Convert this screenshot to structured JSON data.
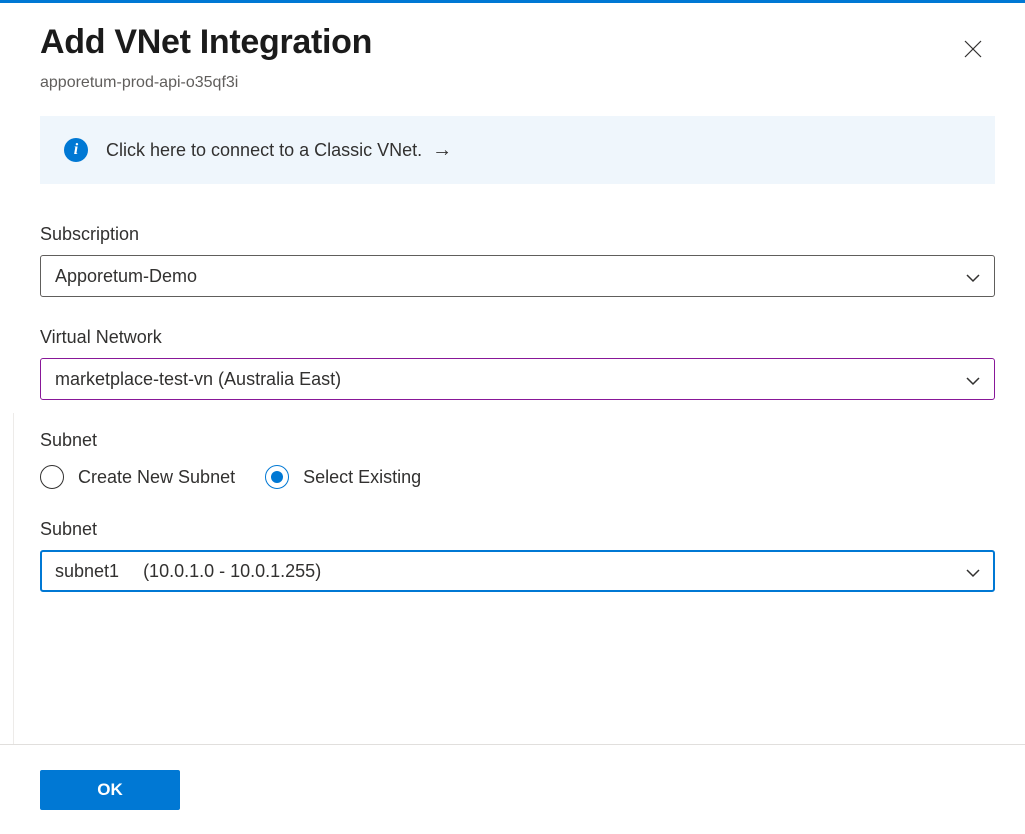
{
  "header": {
    "title": "Add VNet Integration",
    "subtitle": "apporetum-prod-api-o35qf3i"
  },
  "banner": {
    "text": "Click here to connect to a Classic VNet."
  },
  "fields": {
    "subscription": {
      "label": "Subscription",
      "value": "Apporetum-Demo"
    },
    "vnet": {
      "label": "Virtual Network",
      "value": "marketplace-test-vn (Australia East)"
    },
    "subnet_mode": {
      "label": "Subnet",
      "options": {
        "create": "Create New Subnet",
        "existing": "Select Existing"
      },
      "selected": "existing"
    },
    "subnet": {
      "label": "Subnet",
      "value_name": "subnet1",
      "value_range": "(10.0.1.0 - 10.0.1.255)"
    }
  },
  "footer": {
    "ok": "OK"
  }
}
